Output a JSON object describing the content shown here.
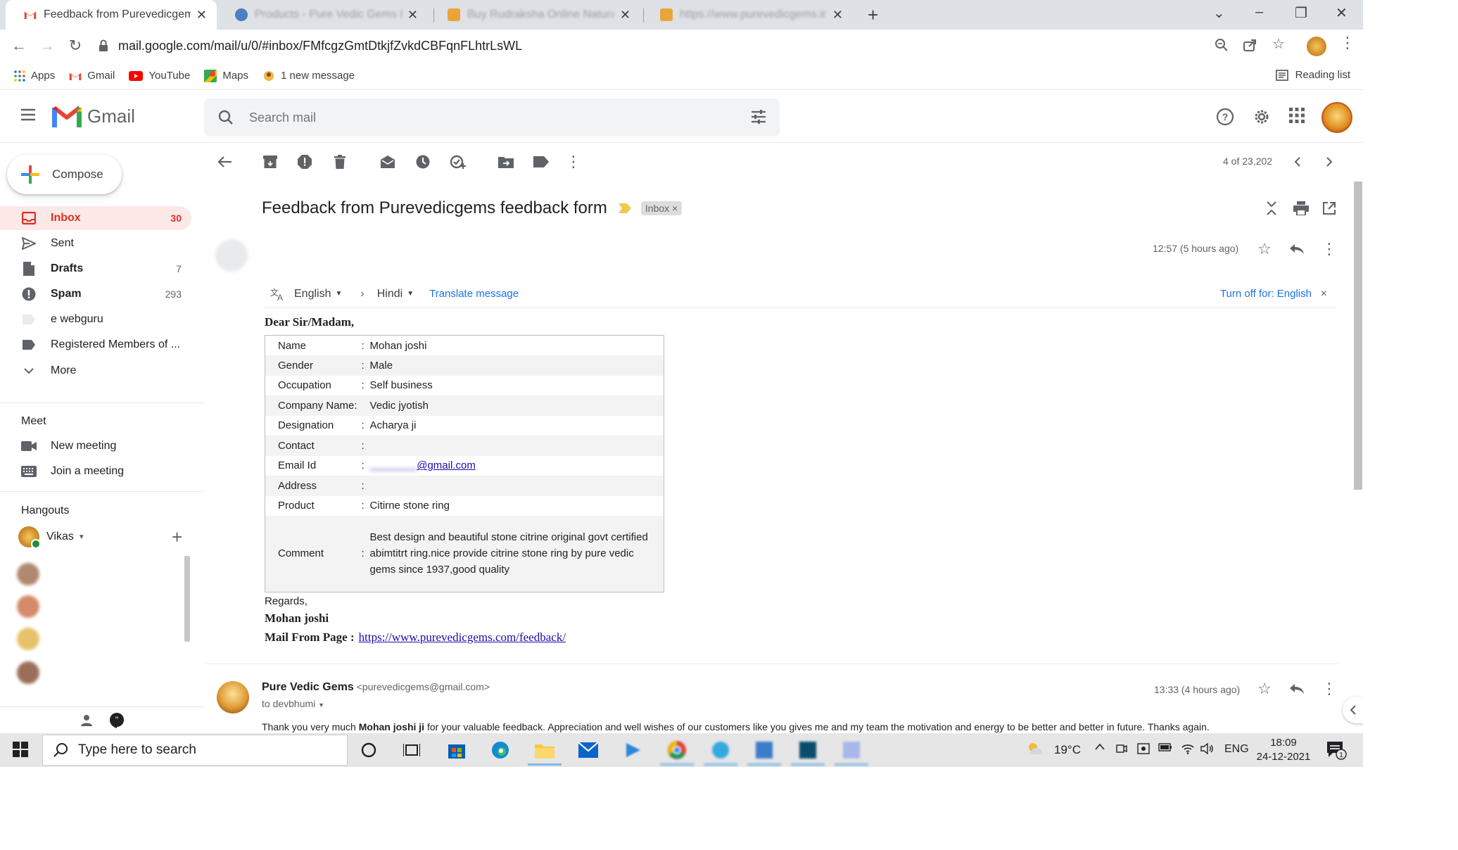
{
  "browser": {
    "tabs": [
      {
        "title": "Feedback from Purevedicgems fe",
        "active": true
      },
      {
        "title": "Products - Pure Vedic Gems Ltd",
        "active": false
      },
      {
        "title": "Buy Rudraksha Online Natural R",
        "active": false
      },
      {
        "title": "https://www.purevedicgems.in/p",
        "active": false
      }
    ],
    "url": "mail.google.com/mail/u/0/#inbox/FMfcgzGmtDtkjfZvkdCBFqnFLhtrLsWL",
    "bookmarks": [
      {
        "label": "Apps",
        "icon": "apps-grid-icon"
      },
      {
        "label": "Gmail",
        "icon": "gmail-icon"
      },
      {
        "label": "YouTube",
        "icon": "youtube-icon"
      },
      {
        "label": "Maps",
        "icon": "maps-icon"
      },
      {
        "label": "1 new message",
        "icon": "notification-favicon"
      }
    ],
    "reading_list": "Reading list"
  },
  "gmail": {
    "logo": "Gmail",
    "search_placeholder": "Search mail",
    "compose": "Compose",
    "nav": [
      {
        "label": "Inbox",
        "count": "30",
        "icon": "inbox-icon",
        "active": true
      },
      {
        "label": "Sent",
        "count": "",
        "icon": "send-icon"
      },
      {
        "label": "Drafts",
        "count": "7",
        "icon": "draft-icon"
      },
      {
        "label": "Spam",
        "count": "293",
        "icon": "spam-icon"
      },
      {
        "label": "e webguru",
        "count": "",
        "icon": "label-icon"
      },
      {
        "label": "Registered Members of ...",
        "count": "",
        "icon": "label-icon"
      },
      {
        "label": "More",
        "count": "",
        "icon": "chevron-down-icon"
      }
    ],
    "meet": {
      "title": "Meet",
      "new_meeting": "New meeting",
      "join_meeting": "Join a meeting"
    },
    "hangouts": {
      "title": "Hangouts",
      "user": "Vikas"
    },
    "pager": "4 of 23,202"
  },
  "message": {
    "subject": "Feedback from Purevedicgems feedback form",
    "label_chip": "Inbox",
    "time": "12:57 (5 hours ago)",
    "translate": {
      "from_lang": "English",
      "to_lang": "Hindi",
      "translate_link": "Translate message",
      "turn_off": "Turn off for: English"
    },
    "greeting": "Dear Sir/Madam,",
    "form": [
      {
        "key": "Name",
        "value": "Mohan joshi"
      },
      {
        "key": "Gender",
        "value": "Male"
      },
      {
        "key": "Occupation",
        "value": "Self business"
      },
      {
        "key": "Company Name:",
        "value": "Vedic jyotish"
      },
      {
        "key": "Designation",
        "value": "Acharya ji"
      },
      {
        "key": "Contact",
        "value": ""
      },
      {
        "key": "Email Id",
        "value": "@gmail.com"
      },
      {
        "key": "Address",
        "value": ""
      },
      {
        "key": "Product",
        "value": "Citirne stone ring"
      },
      {
        "key": "Comment",
        "value": "Best design and beautiful stone citrine original govt certified abimtitrt ring.nice provide citrine stone ring by pure vedic gems since 1937,good quality"
      }
    ],
    "regards": "Regards,",
    "signature": "Mohan joshi",
    "mail_from_label": "Mail From Page :",
    "mail_from_url": "https://www.purevedicgems.com/feedback/"
  },
  "reply": {
    "sender": "Pure Vedic Gems",
    "email": "<purevedicgems@gmail.com>",
    "to": "to devbhumi",
    "time": "13:33 (4 hours ago)",
    "body_prefix": "Thank you very much ",
    "body_name": "Mohan joshi  ji",
    "body_suffix": " for your valuable feedback. Appreciation and well wishes of our customers like you gives me and my team the motivation and energy to be better and better in future. Thanks again."
  },
  "taskbar": {
    "search_placeholder": "Type here to search",
    "temperature": "19°C",
    "language": "ENG",
    "time": "18:09",
    "date": "24-12-2021",
    "notification_count": "1"
  }
}
